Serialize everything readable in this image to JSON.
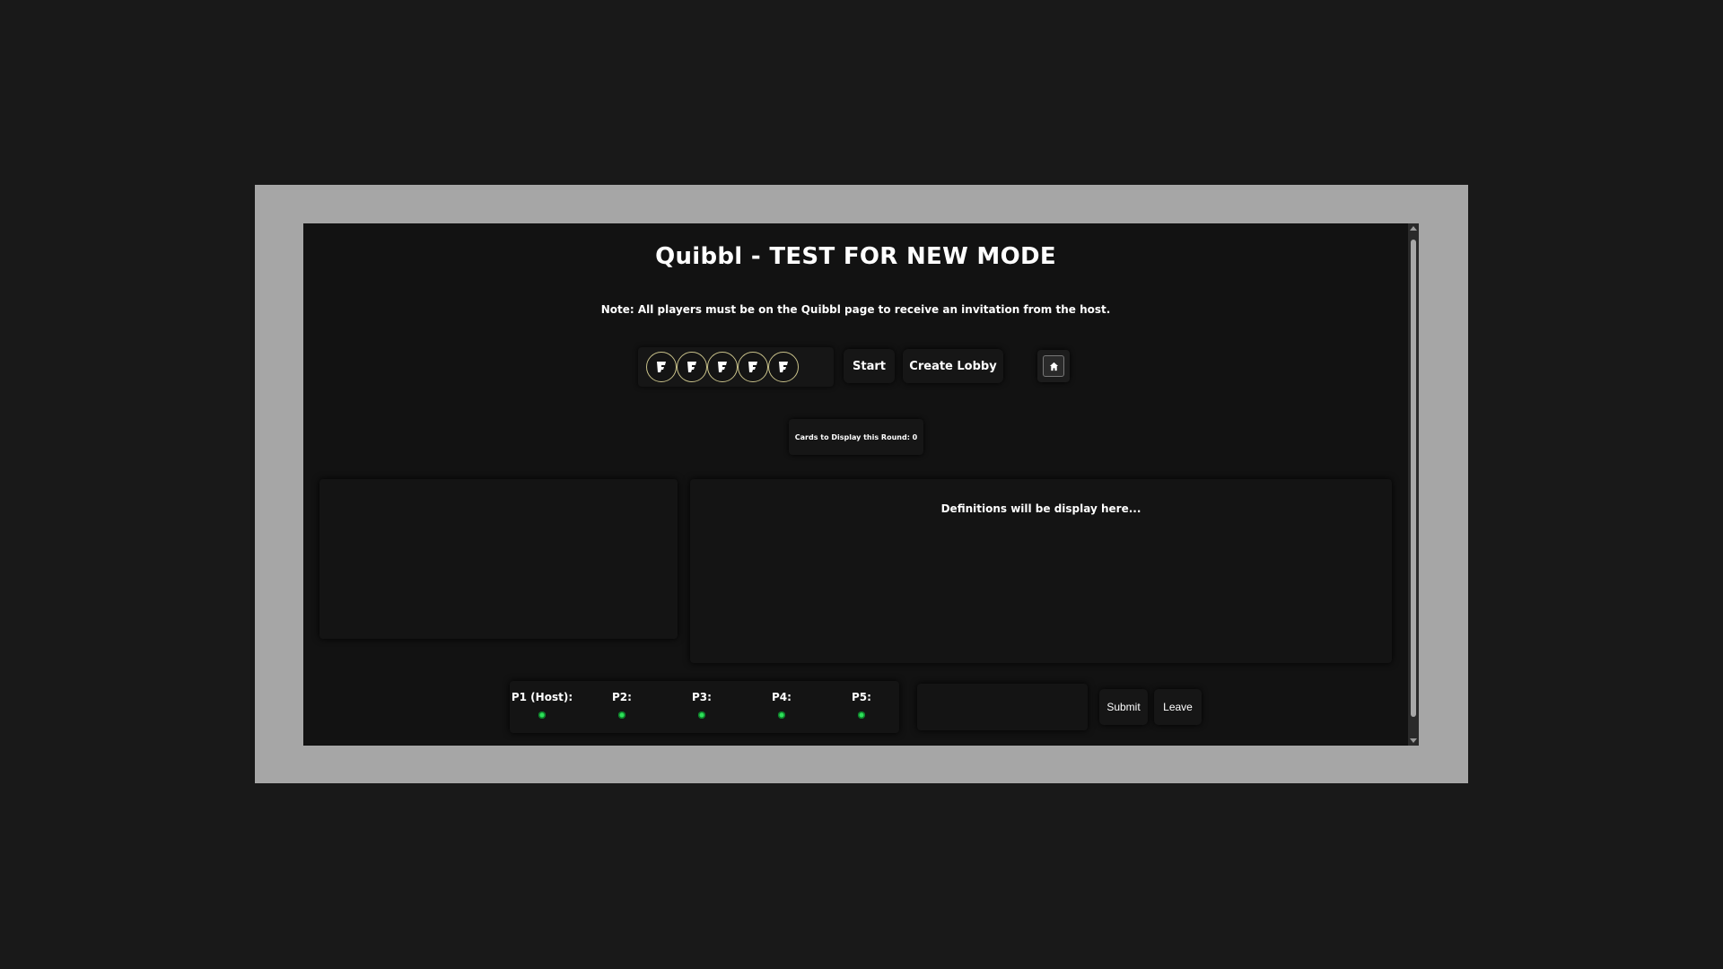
{
  "header": {
    "title": "Quibbl - TEST FOR NEW MODE",
    "note": "Note: All players must be on the Quibbl page to receive an invitation from the host."
  },
  "controls": {
    "coins": [
      "coin-1",
      "coin-2",
      "coin-3",
      "coin-4",
      "coin-5"
    ],
    "start_label": "Start",
    "create_lobby_label": "Create Lobby",
    "home_icon": "home-icon"
  },
  "round": {
    "label": "Cards to Display this Round: 0"
  },
  "definitions": {
    "placeholder": "Definitions will be display here..."
  },
  "players": [
    {
      "label": "P1 (Host):",
      "status_color": "#2ee05a"
    },
    {
      "label": "P2:",
      "status_color": "#2ee05a"
    },
    {
      "label": "P3:",
      "status_color": "#2ee05a"
    },
    {
      "label": "P4:",
      "status_color": "#2ee05a"
    },
    {
      "label": "P5:",
      "status_color": "#2ee05a"
    }
  ],
  "actions": {
    "submit_label": "Submit",
    "leave_label": "Leave",
    "answer_value": ""
  },
  "colors": {
    "background": "#191919",
    "frame": "#a6a6a6",
    "app_bg": "#121212",
    "status_online": "#2ee05a",
    "coin_border": "#c9c28a"
  }
}
